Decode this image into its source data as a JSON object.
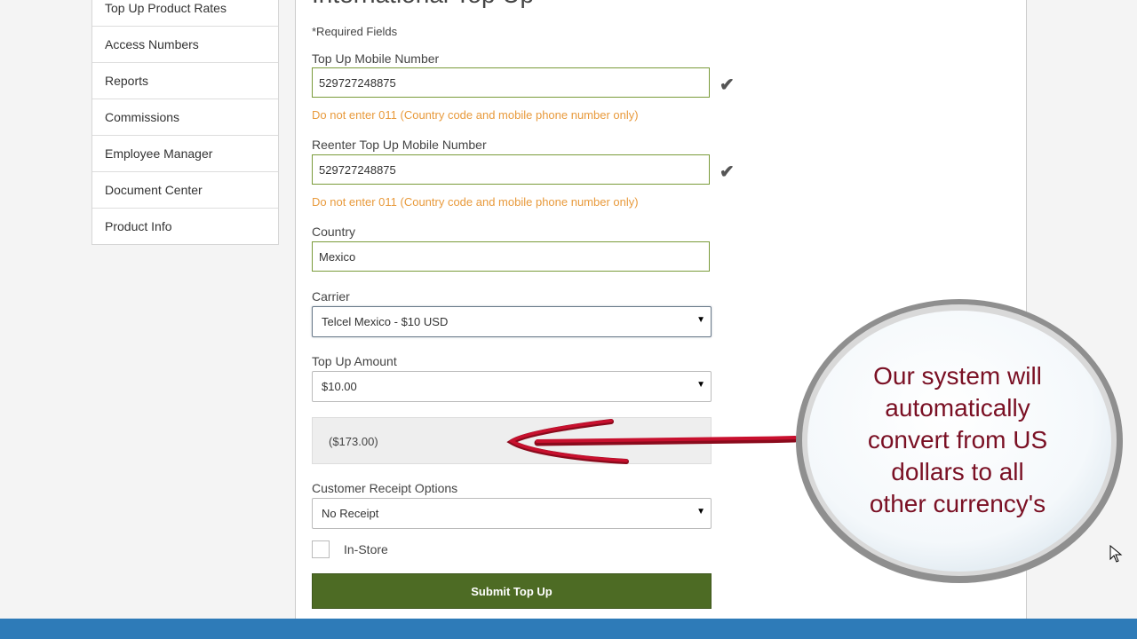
{
  "sidebar": {
    "items": [
      {
        "label": "Top Up Product Rates"
      },
      {
        "label": "Access Numbers"
      },
      {
        "label": "Reports"
      },
      {
        "label": "Commissions"
      },
      {
        "label": "Employee Manager"
      },
      {
        "label": "Document Center"
      },
      {
        "label": "Product Info"
      }
    ]
  },
  "form": {
    "title": "International Top Up",
    "required_note": "*Required Fields",
    "mobile": {
      "label": "Top Up Mobile Number",
      "value": "529727248875",
      "hint": "Do not enter 011 (Country code and mobile phone number only)",
      "check_icon": "✔"
    },
    "mobile_confirm": {
      "label": "Reenter Top Up Mobile Number",
      "value": "529727248875",
      "hint": "Do not enter 011 (Country code and mobile phone number only)",
      "check_icon": "✔"
    },
    "country": {
      "label": "Country",
      "value": "Mexico"
    },
    "carrier": {
      "label": "Carrier",
      "selected": "Telcel Mexico - $10 USD"
    },
    "amount": {
      "label": "Top Up Amount",
      "selected": "$10.00"
    },
    "converted_amount": "($173.00)",
    "receipt": {
      "label": "Customer Receipt Options",
      "selected": "No Receipt"
    },
    "in_store": {
      "label": "In-Store",
      "checked": false
    },
    "submit_label": "Submit Top Up",
    "caret": "▼"
  },
  "callout": {
    "lines": [
      "Our system will",
      "automatically",
      "convert from US",
      "dollars to all",
      "other currency's"
    ]
  },
  "colors": {
    "valid_border": "#7a9b3a",
    "hint_text": "#e89a3c",
    "submit_bg": "#4d6b24",
    "bottom_bar": "#2e7bb8",
    "callout_text": "#7a1024",
    "arrow": "#c8102e"
  }
}
